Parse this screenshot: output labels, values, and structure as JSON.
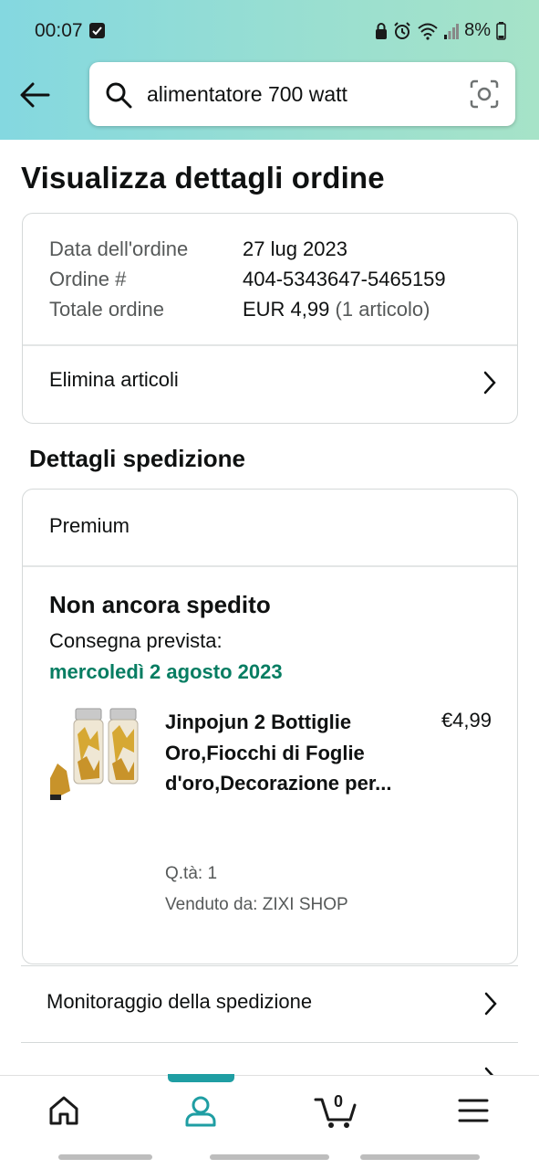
{
  "status_bar": {
    "time": "00:07",
    "battery": "8%"
  },
  "search": {
    "query": "alimentatore 700 watt"
  },
  "page": {
    "title": "Visualizza dettagli ordine"
  },
  "order_summary": {
    "date_label": "Data dell'ordine",
    "date_value": "27 lug 2023",
    "number_label": "Ordine #",
    "number_value": "404-5343647-5465159",
    "total_label": "Totale ordine",
    "total_value": "EUR 4,99",
    "total_items": "(1 articolo)",
    "remove_items": "Elimina articoli"
  },
  "shipping": {
    "section_title": "Dettagli spedizione",
    "service": "Premium",
    "status": "Non ancora spedito",
    "delivery_label": "Consegna prevista:",
    "delivery_date": "mercoledì 2 agosto 2023",
    "product": {
      "title": "Jinpojun 2 Bottiglie Oro,Fiocchi di Foglie d'oro,Decorazione per...",
      "price": "€4,99",
      "qty": "Q.tà: 1",
      "seller": "Venduto da: ZIXI SHOP"
    }
  },
  "links": {
    "tracking": "Monitoraggio della spedizione"
  },
  "bottom_nav": {
    "cart_count": "0"
  },
  "colors": {
    "accent": "#1f9ea3",
    "delivery_green": "#067d62",
    "header_gradient_start": "#84d8e0",
    "header_gradient_end": "#a6e3c8"
  }
}
